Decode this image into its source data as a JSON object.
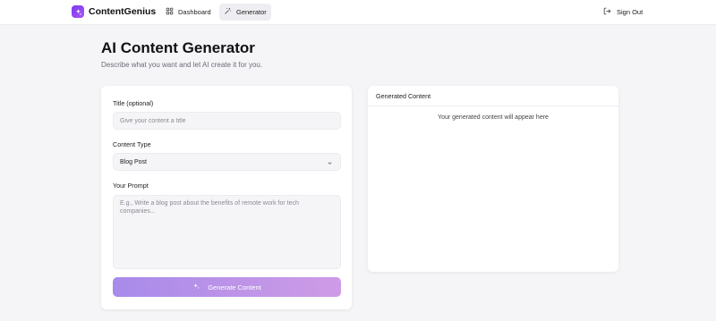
{
  "app": {
    "name": "ContentGenius"
  },
  "nav": {
    "dashboard": "Dashboard",
    "generator": "Generator",
    "sign_out": "Sign Out"
  },
  "page": {
    "title": "AI Content Generator",
    "subtitle": "Describe what you want and let AI create it for you."
  },
  "form": {
    "title_label": "Title (optional)",
    "title_placeholder": "Give your content a title",
    "title_value": "",
    "type_label": "Content Type",
    "type_value": "Blog Post",
    "prompt_label": "Your Prompt",
    "prompt_placeholder": "E.g., Write a blog post about the benefits of remote work for tech companies...",
    "prompt_value": "",
    "generate_label": "Generate Content"
  },
  "output": {
    "header": "Generated Content",
    "empty_text": "Your generated content will appear here"
  },
  "colors": {
    "brand": "#7c3aed",
    "button_gradient_start": "#a78bea",
    "button_gradient_end": "#cf9be6",
    "background": "#f5f5f8"
  },
  "icons": {
    "brand": "sparkle-icon",
    "dashboard": "grid-icon",
    "generator": "magic-wand-icon",
    "sign_out": "logout-icon",
    "select": "chevron-down-icon",
    "generate": "sparkle-icon"
  }
}
